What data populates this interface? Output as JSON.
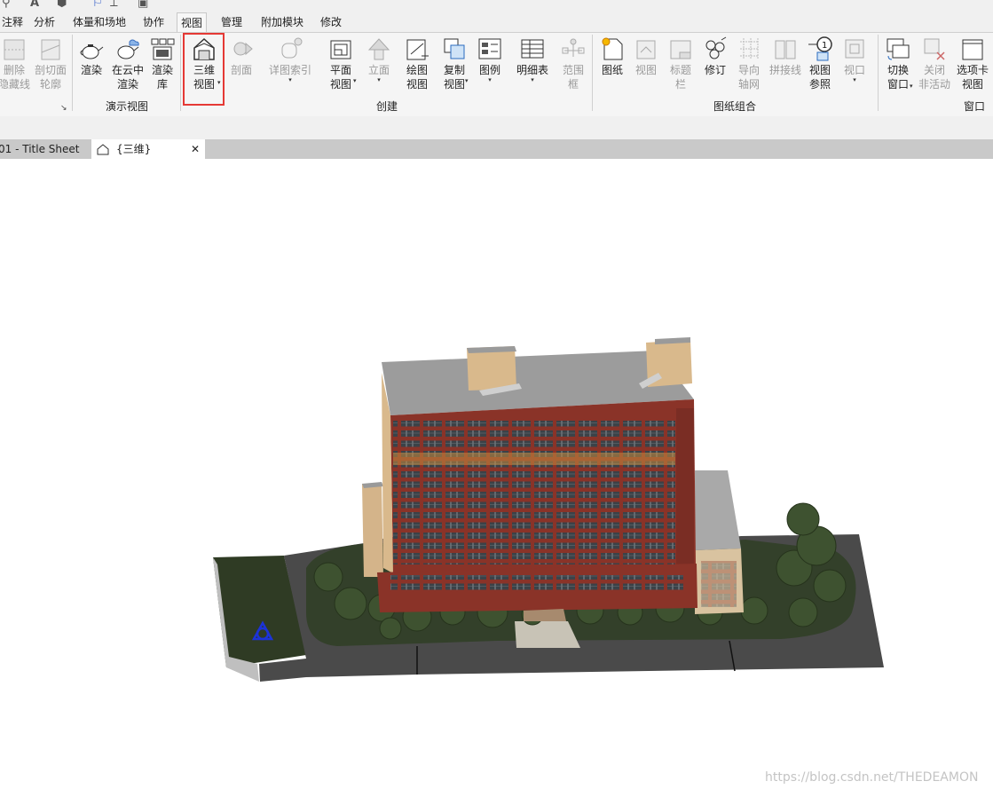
{
  "menubar": {
    "tabs": [
      "注释",
      "分析",
      "体量和场地",
      "协作",
      "视图",
      "管理",
      "附加模块",
      "修改"
    ],
    "active": "视图"
  },
  "ribbon": {
    "graphics": {
      "remove_hidden_lines": "删除\n隐藏线",
      "cut_profile": "剖切面\n轮廓"
    },
    "presentation": {
      "render": "渲染",
      "cloud_render": "在云中\n渲染",
      "render_gallery": "渲染\n库",
      "group_label": "演示视图"
    },
    "create": {
      "view_3d": "三维\n视图",
      "section": "剖面",
      "callout": "详图索引",
      "plan_views": "平面\n视图",
      "elevation": "立面",
      "drafting_view": "绘图\n视图",
      "duplicate_view": "复制\n视图",
      "legends": "图例",
      "schedules": "明细表",
      "scope_box": "范围\n框",
      "group_label": "创建"
    },
    "sheet_composition": {
      "sheet": "图纸",
      "view": "视图",
      "title_block": "标题\n栏",
      "revisions": "修订",
      "guide_grid": "导向\n轴网",
      "matchline": "拼接线",
      "view_reference": "视图\n参照",
      "viewports": "视口",
      "group_label": "图纸组合"
    },
    "windows": {
      "switch_windows": "切换\n窗口",
      "close_inactive": "关闭\n非活动",
      "tab_views": "选项卡\n视图",
      "group_label": "窗口"
    }
  },
  "doc_tabs": [
    {
      "label": "01 - Title Sheet"
    },
    {
      "label": "{三维}",
      "close": "✕"
    }
  ],
  "watermark": "https://blog.csdn.net/THEDEAMON",
  "colors": {
    "highlight": "#e53935",
    "tab_bar": "#c9c9c9",
    "ribbon": "#f5f5f5"
  }
}
